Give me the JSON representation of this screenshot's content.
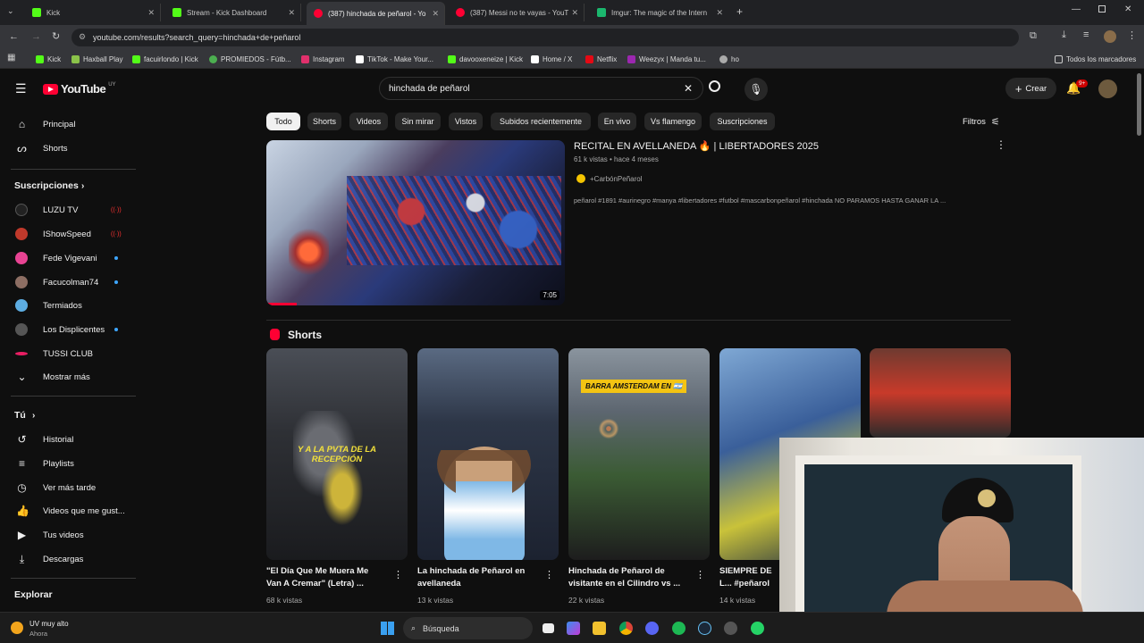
{
  "browser": {
    "tabs": [
      {
        "title": "Kick",
        "color": "#53fc18"
      },
      {
        "title": "Stream - Kick Dashboard",
        "color": "#53fc18"
      },
      {
        "title": "(387) hinchada de peñarol - Yo",
        "color": "#ff0033"
      },
      {
        "title": "(387) Messi no te vayas - YouT",
        "color": "#ff0033"
      },
      {
        "title": "Imgur: The magic of the Intern",
        "color": "#1bb76e"
      }
    ],
    "url": "youtube.com/results?search_query=hinchada+de+peñarol",
    "bookmarks": [
      {
        "label": "Kick",
        "color": "#53fc18"
      },
      {
        "label": "Haxball Play",
        "color": "#8bc34a"
      },
      {
        "label": "facuirlondo | Kick",
        "color": "#53fc18"
      },
      {
        "label": "PROMIEDOS - Fútb...",
        "color": "#4caf50"
      },
      {
        "label": "Instagram",
        "color": "#e1306c"
      },
      {
        "label": "TikTok - Make Your...",
        "color": "#ffffff"
      },
      {
        "label": "davooxeneize | Kick",
        "color": "#53fc18"
      },
      {
        "label": "Home / X",
        "color": "#ffffff"
      },
      {
        "label": "Netflix",
        "color": "#e50914"
      },
      {
        "label": "Weezyx | Manda tu...",
        "color": "#9c27b0"
      },
      {
        "label": "ho",
        "color": "#aaaaaa"
      }
    ],
    "all_bookmarks": "Todos los marcadores"
  },
  "yt": {
    "logo": "YouTube",
    "logo_country": "UY",
    "search_value": "hinchada de peñarol",
    "create_label": "Crear",
    "notif_count": "9+",
    "sidebar": {
      "main": [
        {
          "label": "Principal",
          "icon": "home-icon"
        },
        {
          "label": "Shorts",
          "icon": "shorts-icon"
        }
      ],
      "subs_header": "Suscripciones",
      "subs": [
        {
          "label": "LUZU TV",
          "color": "#222222",
          "status": "live"
        },
        {
          "label": "IShowSpeed",
          "color": "#c0392b",
          "status": "live"
        },
        {
          "label": "Fede Vigevani",
          "color": "#e84393",
          "status": "dot"
        },
        {
          "label": "Facucolman74",
          "color": "#8d6e63",
          "status": "dot"
        },
        {
          "label": "Termiados",
          "color": "#5dade2",
          "status": ""
        },
        {
          "label": "Los Displicentes",
          "color": "#555555",
          "status": "dot"
        },
        {
          "label": "TUSSI CLUB",
          "color": "#e91e63",
          "status": ""
        }
      ],
      "show_more": "Mostrar más",
      "you_header": "Tú",
      "you": [
        {
          "label": "Historial",
          "icon": "history-icon"
        },
        {
          "label": "Playlists",
          "icon": "playlist-icon"
        },
        {
          "label": "Ver más tarde",
          "icon": "clock-icon"
        },
        {
          "label": "Videos que me gust...",
          "icon": "like-icon"
        },
        {
          "label": "Tus videos",
          "icon": "video-icon"
        },
        {
          "label": "Descargas",
          "icon": "download-icon"
        }
      ],
      "explore_header": "Explorar"
    },
    "chips": [
      "Todo",
      "Shorts",
      "Videos",
      "Sin mirar",
      "Vistos",
      "Subidos recientemente",
      "En vivo",
      "Vs flamengo",
      "Suscripciones"
    ],
    "filters": "Filtros",
    "video": {
      "title": "RECITAL EN AVELLANEDA 🔥 | LIBERTADORES 2025",
      "meta": "61 k vistas • hace 4 meses",
      "channel": "+CarbónPeñarol",
      "desc": "peñarol #1891 #aurinegro #manya #libertadores #futbol #mascarbonpeñarol #hinchada NO PARAMOS HASTA GANAR LA ...",
      "duration": "7:05"
    },
    "shorts_header": "Shorts",
    "shorts": [
      {
        "title": "\"El Día Que Me Muera Me Van A Cremar\" (Letra) ...",
        "views": "68 k vistas",
        "overlay": "Y A LA PVTA DE LA RECEPCIÓN"
      },
      {
        "title": "La hinchada de Peñarol en avellaneda",
        "views": "13 k vistas",
        "overlay": ""
      },
      {
        "title": "Hinchada de Peñarol de visitante en el Cilindro vs ...",
        "views": "22 k vistas",
        "overlay": "BARRA AMSTERDAM EN 🇦🇷"
      },
      {
        "title": "SIEMPRE DE L... #peñarol #cop...",
        "views": "14 k vistas",
        "overlay": ""
      },
      {
        "title": "",
        "views": "",
        "overlay": ""
      }
    ]
  },
  "taskbar": {
    "weather_temp": "UV muy alto",
    "weather_sub": "Ahora",
    "search": "Búsqueda"
  }
}
